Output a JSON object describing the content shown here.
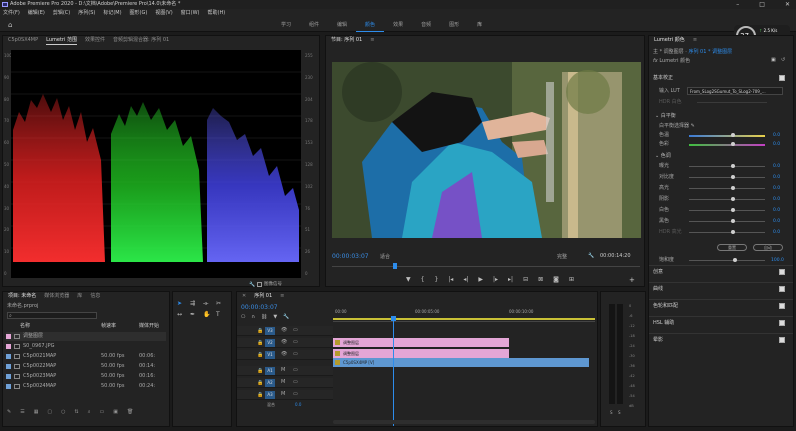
{
  "window": {
    "title": "Adobe Premiere Pro 2020 - D:\\文档\\Adobe\\Premiere Pro\\14.0\\未命名 *"
  },
  "menu": [
    "文件(F)",
    "编辑(E)",
    "剪辑(C)",
    "序列(S)",
    "标记(M)",
    "图形(G)",
    "视图(V)",
    "窗口(W)",
    "帮助(H)"
  ],
  "workspaces": {
    "items": [
      "学习",
      "组件",
      "编辑",
      "颜色",
      "效果",
      "音频",
      "图形",
      "库"
    ],
    "active_index": 3,
    "more": "»"
  },
  "badge": {
    "value": "37",
    "unit": "%",
    "up": "2.5",
    "down": "0.1",
    "rate_unit": "K/s"
  },
  "scopes": {
    "tabs": [
      "C5p0SX4MP",
      "Lumetri 范围",
      "效果控件",
      "音频剪辑混合器: 序列 01"
    ],
    "active": 1,
    "left_scale": [
      "100",
      "90",
      "80",
      "70",
      "60",
      "50",
      "40",
      "30",
      "20",
      "10",
      "0"
    ],
    "right_scale": [
      "255",
      "230",
      "204",
      "178",
      "153",
      "128",
      "102",
      "76",
      "51",
      "26",
      "0"
    ],
    "bottom_left": "八",
    "bottom_right": "图像信号"
  },
  "program": {
    "title": "节目: 序列 01",
    "timecode": "00:00:03:07",
    "fit": "适合",
    "full": "完整",
    "duration": "00:00:14:20"
  },
  "lumetri": {
    "tab": "Lumetri 颜色",
    "path_prefix": "主 * 调整图层",
    "path_seq": "序列 01 * 调整图层",
    "fx": "Lumetri 颜色",
    "basic": "基本校正",
    "input_lut_label": "输入 LUT",
    "input_lut_value": "From_SLog2SGumut_To_SLog2-709_...",
    "hdr": "HDR 白色",
    "wb": "白平衡",
    "wb_picker": "白平衡选择器",
    "wb_rows": [
      {
        "label": "色温",
        "value": "0.0"
      },
      {
        "label": "色彩",
        "value": "0.0"
      }
    ],
    "tone": "色调",
    "tone_rows": [
      {
        "label": "曝光",
        "value": "0.0"
      },
      {
        "label": "对比度",
        "value": "0.0"
      },
      {
        "label": "高光",
        "value": "0.0"
      },
      {
        "label": "阴影",
        "value": "0.0"
      },
      {
        "label": "白色",
        "value": "0.0"
      },
      {
        "label": "黑色",
        "value": "0.0"
      },
      {
        "label": "HDR 高光",
        "value": "0.0"
      }
    ],
    "reset": "重置",
    "auto": "自动",
    "sat_label": "饱和度",
    "sat_value": "100.0",
    "sections": [
      "创意",
      "曲线",
      "色轮和匹配",
      "HSL 辅助",
      "晕影"
    ]
  },
  "project": {
    "tabs": [
      "项目: 未命名",
      "媒体浏览器",
      "库",
      "信息"
    ],
    "file": "未命名.prproj",
    "search_placeholder": "",
    "cols": [
      "名称",
      "帧速率",
      "媒体开始"
    ],
    "rows": [
      {
        "name": "调整图层",
        "fps": "",
        "start": "",
        "color": "#e4a6d6"
      },
      {
        "name": "S0_0967.JPG",
        "fps": "",
        "start": "",
        "color": "#e4a6d6"
      },
      {
        "name": "C5p0021MAP",
        "fps": "50.00 fps",
        "start": "00:06:",
        "color": "#6fa0d6"
      },
      {
        "name": "C5p0022MAP",
        "fps": "50.00 fps",
        "start": "00:14:",
        "color": "#6fa0d6"
      },
      {
        "name": "C5p0023MAP",
        "fps": "50.00 fps",
        "start": "00:16:",
        "color": "#6fa0d6"
      },
      {
        "name": "C5p0024MAP",
        "fps": "50.00 fps",
        "start": "00:24:",
        "color": "#6fa0d6"
      }
    ]
  },
  "timeline": {
    "title": "序列 01",
    "timecode": "00:00:03:07",
    "ruler": [
      "00:00",
      "00:00:05:00",
      "00:00:10:00"
    ],
    "video_tracks": [
      "V3",
      "V2",
      "V1"
    ],
    "audio_tracks": [
      "A1",
      "A2",
      "A3"
    ],
    "audio_mix": "混合",
    "clips": [
      {
        "label": "调整图层",
        "color": "#e4a6d6"
      },
      {
        "label": "调整图层",
        "color": "#e4a6d6"
      },
      {
        "label": "C5p0SX4MP [V]",
        "color": "#5e97d1"
      }
    ],
    "mix_value": "0.0"
  },
  "meter": {
    "scale": [
      "0",
      "-6",
      "-12",
      "-18",
      "-24",
      "-30",
      "-36",
      "-42",
      "-48",
      "-54",
      "dB"
    ],
    "s_labels": [
      "S",
      "S"
    ]
  }
}
